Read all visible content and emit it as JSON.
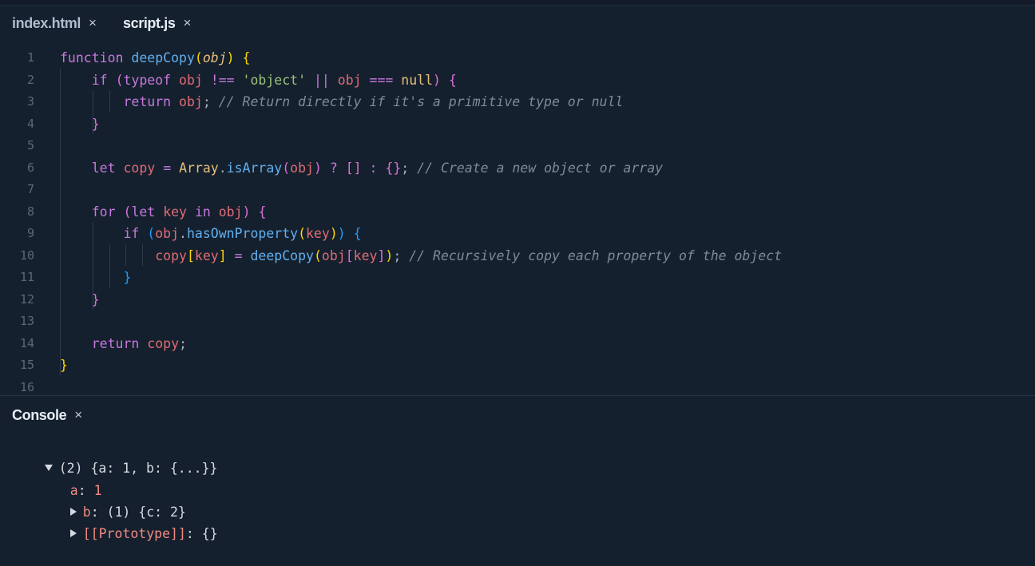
{
  "tabs": [
    {
      "label": "index.html",
      "active": false
    },
    {
      "label": "script.js",
      "active": true
    }
  ],
  "tab_close_glyph": "×",
  "editor": {
    "line_numbers": [
      "1",
      "2",
      "3",
      "4",
      "5",
      "6",
      "7",
      "8",
      "9",
      "10",
      "11",
      "12",
      "13",
      "14",
      "15",
      "16"
    ],
    "lines": [
      [
        [
          "kw",
          "function"
        ],
        [
          "plain",
          " "
        ],
        [
          "fn",
          "deepCopy"
        ],
        [
          "b1",
          "("
        ],
        [
          "param",
          "obj"
        ],
        [
          "b1",
          ")"
        ],
        [
          "plain",
          " "
        ],
        [
          "b1",
          "{"
        ]
      ],
      [
        [
          "plain",
          "    "
        ],
        [
          "kw",
          "if"
        ],
        [
          "plain",
          " "
        ],
        [
          "b2",
          "("
        ],
        [
          "kw",
          "typeof"
        ],
        [
          "plain",
          " "
        ],
        [
          "var",
          "obj"
        ],
        [
          "plain",
          " "
        ],
        [
          "kw",
          "!=="
        ],
        [
          "plain",
          " "
        ],
        [
          "str",
          "'object'"
        ],
        [
          "plain",
          " "
        ],
        [
          "kw",
          "||"
        ],
        [
          "plain",
          " "
        ],
        [
          "var",
          "obj"
        ],
        [
          "plain",
          " "
        ],
        [
          "kw",
          "==="
        ],
        [
          "plain",
          " "
        ],
        [
          "cls",
          "null"
        ],
        [
          "b2",
          ")"
        ],
        [
          "plain",
          " "
        ],
        [
          "b2",
          "{"
        ]
      ],
      [
        [
          "plain",
          "        "
        ],
        [
          "kw",
          "return"
        ],
        [
          "plain",
          " "
        ],
        [
          "var",
          "obj"
        ],
        [
          "plain",
          "; "
        ],
        [
          "cmt",
          "// Return directly if it's a primitive type or null"
        ]
      ],
      [
        [
          "plain",
          "    "
        ],
        [
          "b2",
          "}"
        ]
      ],
      [],
      [
        [
          "plain",
          "    "
        ],
        [
          "kw",
          "let"
        ],
        [
          "plain",
          " "
        ],
        [
          "var",
          "copy"
        ],
        [
          "plain",
          " "
        ],
        [
          "kw",
          "="
        ],
        [
          "plain",
          " "
        ],
        [
          "cls",
          "Array"
        ],
        [
          "plain",
          "."
        ],
        [
          "fn",
          "isArray"
        ],
        [
          "b2",
          "("
        ],
        [
          "var",
          "obj"
        ],
        [
          "b2",
          ")"
        ],
        [
          "plain",
          " "
        ],
        [
          "kw",
          "?"
        ],
        [
          "plain",
          " "
        ],
        [
          "b2",
          "[]"
        ],
        [
          "plain",
          " "
        ],
        [
          "kw",
          ":"
        ],
        [
          "plain",
          " "
        ],
        [
          "b2",
          "{}"
        ],
        [
          "plain",
          "; "
        ],
        [
          "cmt",
          "// Create a new object or array"
        ]
      ],
      [],
      [
        [
          "plain",
          "    "
        ],
        [
          "kw",
          "for"
        ],
        [
          "plain",
          " "
        ],
        [
          "b2",
          "("
        ],
        [
          "kw",
          "let"
        ],
        [
          "plain",
          " "
        ],
        [
          "var",
          "key"
        ],
        [
          "plain",
          " "
        ],
        [
          "kw",
          "in"
        ],
        [
          "plain",
          " "
        ],
        [
          "var",
          "obj"
        ],
        [
          "b2",
          ")"
        ],
        [
          "plain",
          " "
        ],
        [
          "b2",
          "{"
        ]
      ],
      [
        [
          "plain",
          "        "
        ],
        [
          "kw",
          "if"
        ],
        [
          "plain",
          " "
        ],
        [
          "b3",
          "("
        ],
        [
          "var",
          "obj"
        ],
        [
          "plain",
          "."
        ],
        [
          "fn",
          "hasOwnProperty"
        ],
        [
          "b1",
          "("
        ],
        [
          "var",
          "key"
        ],
        [
          "b1",
          ")"
        ],
        [
          "b3",
          ")"
        ],
        [
          "plain",
          " "
        ],
        [
          "b3",
          "{"
        ]
      ],
      [
        [
          "plain",
          "            "
        ],
        [
          "var",
          "copy"
        ],
        [
          "b1",
          "["
        ],
        [
          "var",
          "key"
        ],
        [
          "b1",
          "]"
        ],
        [
          "plain",
          " "
        ],
        [
          "kw",
          "="
        ],
        [
          "plain",
          " "
        ],
        [
          "fn",
          "deepCopy"
        ],
        [
          "b1",
          "("
        ],
        [
          "var",
          "obj"
        ],
        [
          "b2",
          "["
        ],
        [
          "var",
          "key"
        ],
        [
          "b2",
          "]"
        ],
        [
          "b1",
          ")"
        ],
        [
          "plain",
          "; "
        ],
        [
          "cmt",
          "// Recursively copy each property of the object"
        ]
      ],
      [
        [
          "plain",
          "        "
        ],
        [
          "b3",
          "}"
        ]
      ],
      [
        [
          "plain",
          "    "
        ],
        [
          "b2",
          "}"
        ]
      ],
      [],
      [
        [
          "plain",
          "    "
        ],
        [
          "kw",
          "return"
        ],
        [
          "plain",
          " "
        ],
        [
          "var",
          "copy"
        ],
        [
          "plain",
          ";"
        ]
      ],
      [
        [
          "b1",
          "}"
        ]
      ],
      []
    ]
  },
  "console": {
    "title": "Console",
    "root": {
      "count": "(2)",
      "preview": "{a: 1, b: {...}}"
    },
    "entries": [
      {
        "key": "a",
        "sep": ": ",
        "value": "1",
        "expandable": false
      },
      {
        "key": "b",
        "sep": ": ",
        "value": "(1) {c: 2}",
        "expandable": true
      },
      {
        "key": "[[Prototype]]",
        "sep": ": ",
        "value": "{}",
        "expandable": true
      }
    ]
  }
}
